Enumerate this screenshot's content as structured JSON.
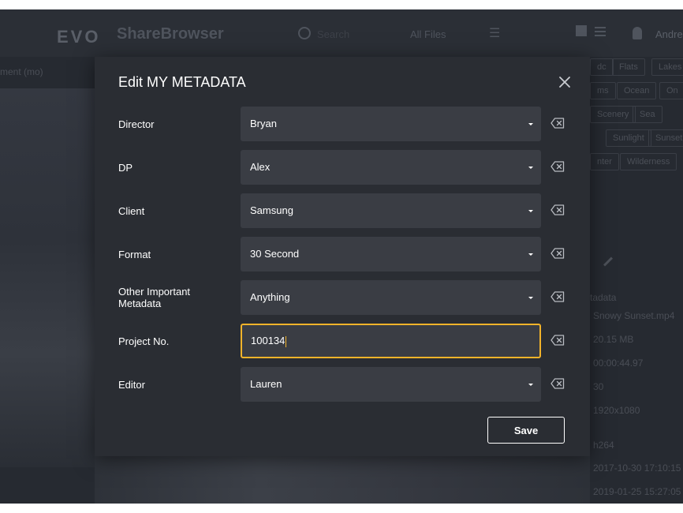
{
  "background": {
    "logo": "EVO",
    "app_name": "ShareBrowser",
    "search_placeholder": "Search",
    "filter_label": "All Files",
    "username": "Andre",
    "left_label": "ment (mo)",
    "tags": [
      "dc",
      "Flats",
      "Lakes",
      "ms",
      "Ocean",
      "On",
      "Scenery",
      "Sea",
      "Sunlight",
      "Sunset",
      "nter",
      "Wilderness"
    ],
    "metadata_title": "tadata",
    "metadata_values": [
      "Snowy Sunset.mp4",
      "20.15 MB",
      "00:00:44.97",
      "30",
      "1920x1080",
      "h264",
      "2017-10-30 17:10:15",
      "2019-01-25 15:27:05"
    ]
  },
  "modal": {
    "title": "Edit MY METADATA",
    "save_label": "Save",
    "fields": [
      {
        "label": "Director",
        "value": "Bryan",
        "type": "select"
      },
      {
        "label": "DP",
        "value": "Alex",
        "type": "select"
      },
      {
        "label": "Client",
        "value": "Samsung",
        "type": "select"
      },
      {
        "label": "Format",
        "value": "30 Second",
        "type": "select"
      },
      {
        "label": "Other Important Metadata",
        "value": "Anything",
        "type": "select"
      },
      {
        "label": "Project No.",
        "value": "100134",
        "type": "text",
        "focused": true
      },
      {
        "label": "Editor",
        "value": "Lauren",
        "type": "select"
      }
    ]
  },
  "colors": {
    "modal_bg": "#2a2d33",
    "field_bg": "#3a3d44",
    "focus_accent": "#f2b32a",
    "text": "#ffffff"
  },
  "icons": {
    "close": "close-icon",
    "clear": "backspace-clear-icon",
    "dropdown": "caret-down-icon"
  }
}
